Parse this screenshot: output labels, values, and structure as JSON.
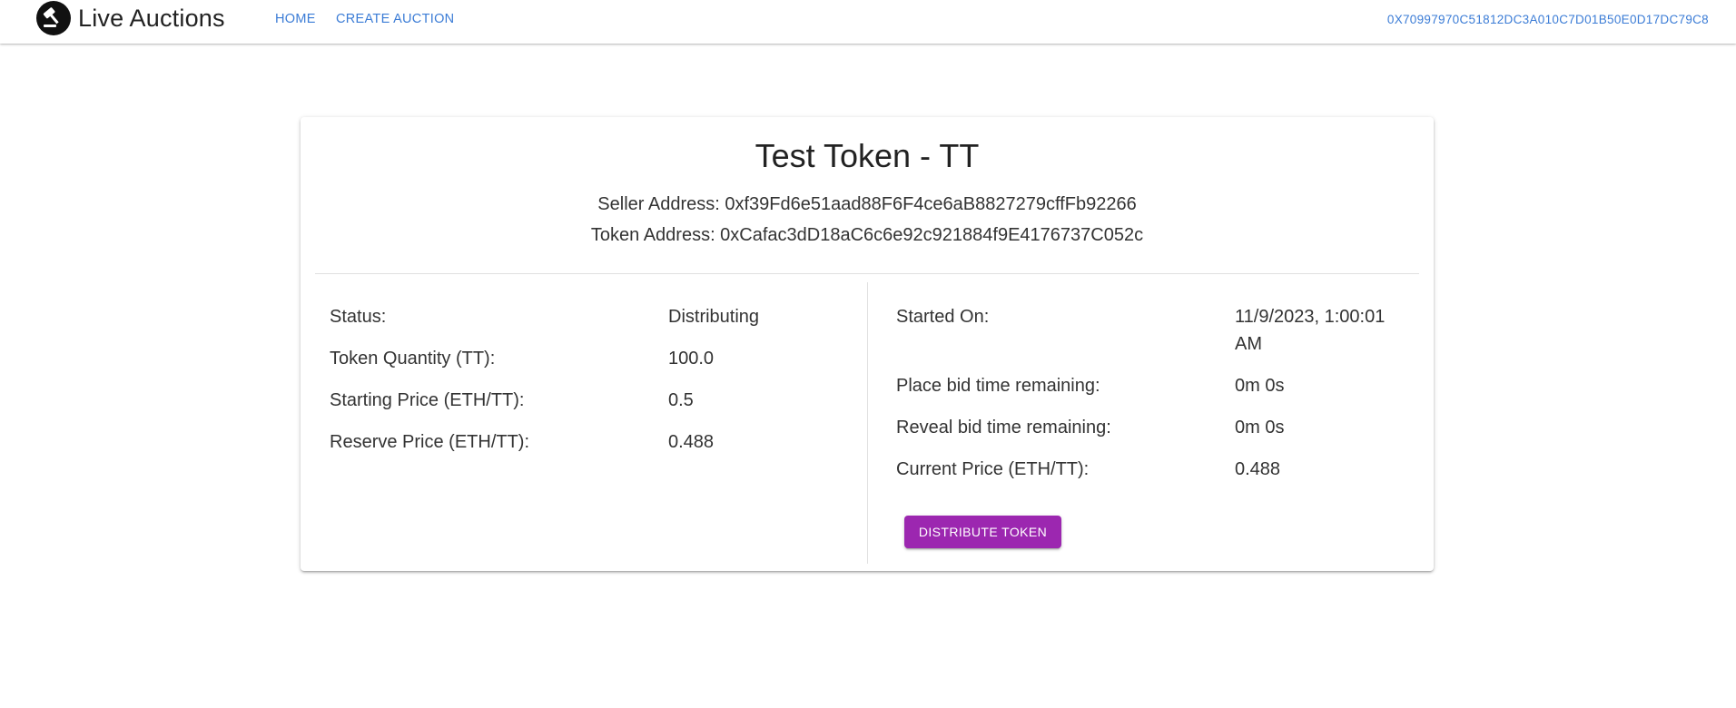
{
  "app": {
    "title": "Live Auctions",
    "logo_icon": "gavel-icon"
  },
  "nav": {
    "home": "HOME",
    "create_auction": "CREATE AUCTION"
  },
  "wallet": {
    "address": "0X70997970C51812DC3A010C7D01B50E0D17DC79C8"
  },
  "auction": {
    "title": "Test Token - TT",
    "seller_address": "Seller Address: 0xf39Fd6e51aad88F6F4ce6aB8827279cffFb92266",
    "token_address": "Token Address: 0xCafac3dD18aC6c6e92c921884f9E4176737C052c",
    "left_rows": [
      {
        "label": "Status:",
        "value": "Distributing"
      },
      {
        "label": "Token Quantity (TT):",
        "value": "100.0"
      },
      {
        "label": "Starting Price (ETH/TT):",
        "value": "0.5"
      },
      {
        "label": "Reserve Price (ETH/TT):",
        "value": "0.488"
      }
    ],
    "right_rows": [
      {
        "label": "Started On:",
        "value_line1": "11/9/2023, 1:00:01",
        "value_line2": "AM"
      },
      {
        "label": "Place bid time remaining:",
        "value": "0m 0s"
      },
      {
        "label": "Reveal bid time remaining:",
        "value": "0m 0s"
      },
      {
        "label": "Current Price (ETH/TT):",
        "value": "0.488"
      }
    ],
    "distribute_button": "DISTRIBUTE TOKEN"
  },
  "colors": {
    "link": "#3b7cd6",
    "button": "#9c27b0",
    "button_text": "#ffffff"
  }
}
